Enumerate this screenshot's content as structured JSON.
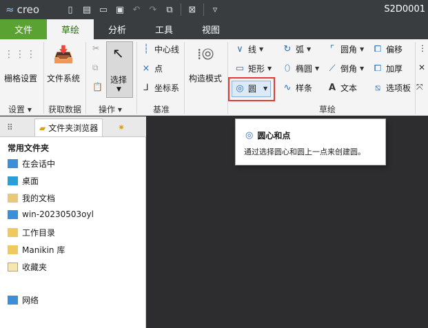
{
  "app": {
    "logo_text": "creo",
    "window_title": "S2D0001"
  },
  "quick_access": {
    "icons": [
      "new-icon",
      "print-icon",
      "open-icon",
      "save-icon",
      "undo-icon",
      "redo-icon",
      "regenerate-icon",
      "close-window-icon",
      "customize-icon"
    ]
  },
  "tabs": [
    {
      "label": "文件"
    },
    {
      "label": "草绘"
    },
    {
      "label": "分析"
    },
    {
      "label": "工具"
    },
    {
      "label": "视图"
    }
  ],
  "ribbon": {
    "settings": {
      "grid_label": "栅格设置",
      "group_label": "设置"
    },
    "get_data": {
      "filesystem_label": "文件系统",
      "group_label": "获取数据"
    },
    "operations": {
      "select_label": "选择",
      "group_label": "操作"
    },
    "datum": {
      "centerline": "中心线",
      "point": "点",
      "coordsys": "坐标系",
      "group_label": "基准"
    },
    "sketch": {
      "construction_mode": "构造模式",
      "line": "线",
      "rectangle": "矩形",
      "circle": "圆",
      "arc": "弧",
      "ellipse": "椭圆",
      "spline": "样条",
      "fillet": "圆角",
      "chamfer": "倒角",
      "text": "文本",
      "offset": "偏移",
      "thicken": "加厚",
      "palette": "选项板",
      "group_label": "草绘"
    }
  },
  "left_panel": {
    "tabs": [
      {
        "label": ""
      },
      {
        "label": "文件夹浏览器"
      },
      {
        "label": ""
      }
    ],
    "section_title": "常用文件夹",
    "items": [
      {
        "label": "在会话中"
      },
      {
        "label": "桌面"
      },
      {
        "label": "我的文档"
      },
      {
        "label": "win-20230503oyl"
      },
      {
        "label": "工作目录"
      },
      {
        "label": "Manikin 库"
      },
      {
        "label": "收藏夹"
      },
      {
        "label": "网络"
      }
    ]
  },
  "tooltip": {
    "title": "圆心和点",
    "description": "通过选择圆心和圆上一点来创建圆。"
  },
  "colors": {
    "file_tab": "#5aa231",
    "active_tab_text": "#2b6a12",
    "highlight": "#e53935",
    "titlebar": "#3a3d40",
    "graphics_area": "#2d2d30"
  }
}
